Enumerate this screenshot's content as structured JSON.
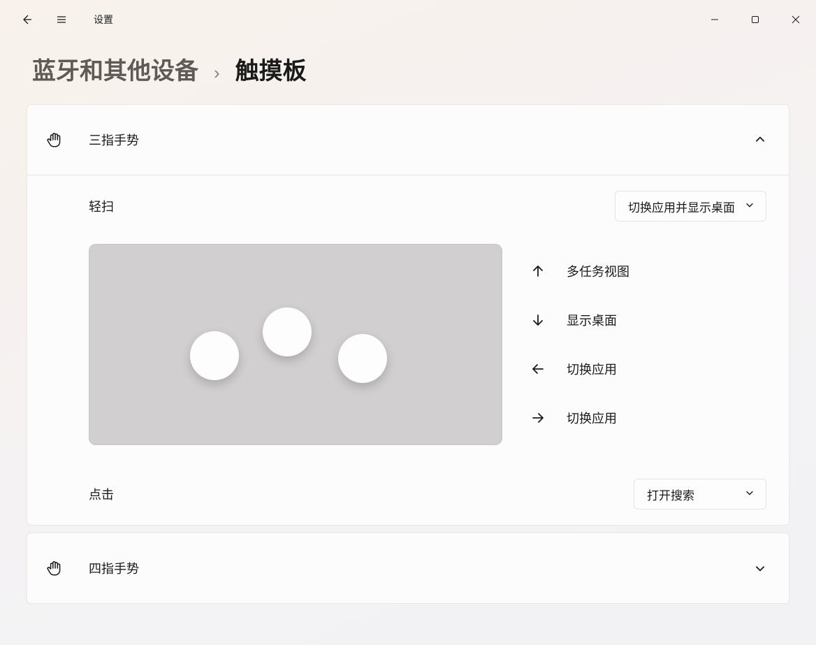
{
  "app_title": "设置",
  "breadcrumb": {
    "parent": "蓝牙和其他设备",
    "separator": "›",
    "current": "触摸板"
  },
  "three_finger": {
    "title": "三指手势",
    "swipe_label": "轻扫",
    "swipe_value": "切换应用并显示桌面",
    "directions": {
      "up": "多任务视图",
      "down": "显示桌面",
      "left": "切换应用",
      "right": "切换应用"
    },
    "tap_label": "点击",
    "tap_value": "打开搜索"
  },
  "four_finger": {
    "title": "四指手势"
  }
}
